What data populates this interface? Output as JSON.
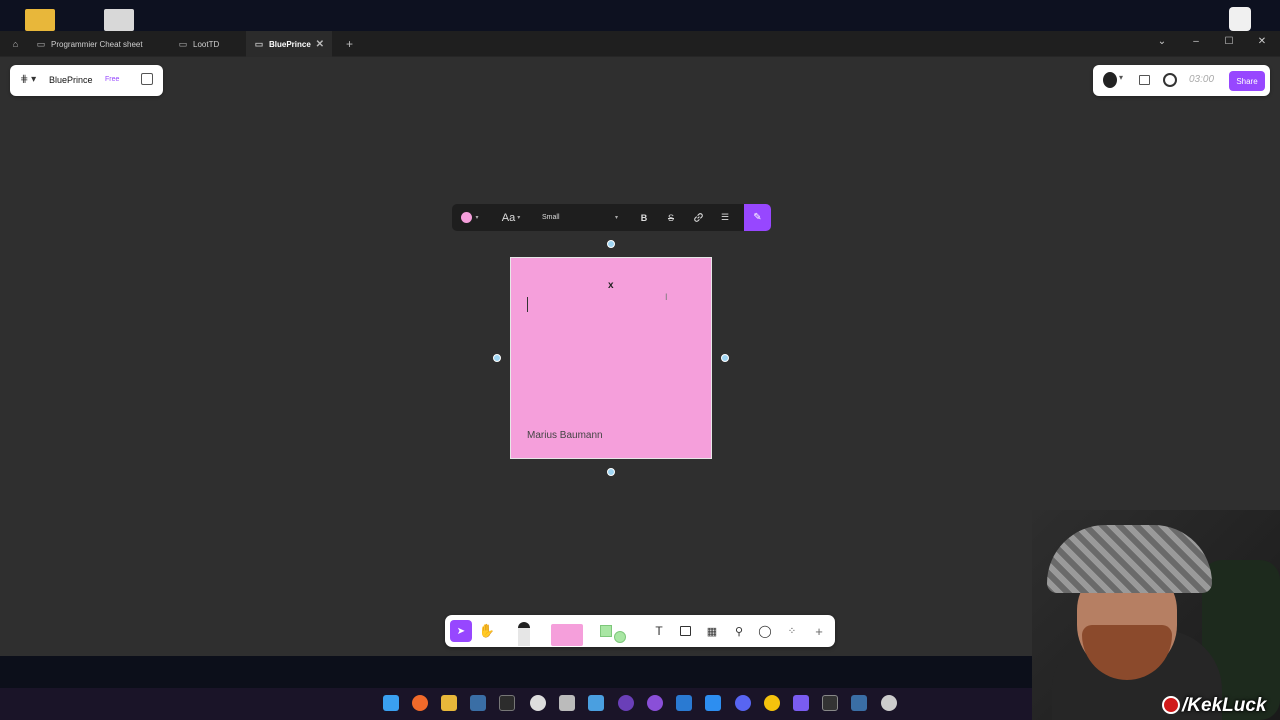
{
  "tabs": [
    {
      "label": "Programmier Cheat sheet"
    },
    {
      "label": "LootTD"
    },
    {
      "label": "BluePrince"
    }
  ],
  "file": {
    "name": "BluePrince",
    "plan": "Free"
  },
  "header_right": {
    "timer": "03:00",
    "share_label": "Share"
  },
  "format_toolbar": {
    "font_label": "Aa",
    "size_label": "Small",
    "bold": "B",
    "strike": "S"
  },
  "sticky": {
    "text": "x",
    "author": "Marius Baumann",
    "color": "#f59fdb"
  },
  "overlay": {
    "channel_text": "/KekLuck"
  },
  "colors": {
    "accent": "#9747ff",
    "canvas": "#2f2f2f"
  }
}
